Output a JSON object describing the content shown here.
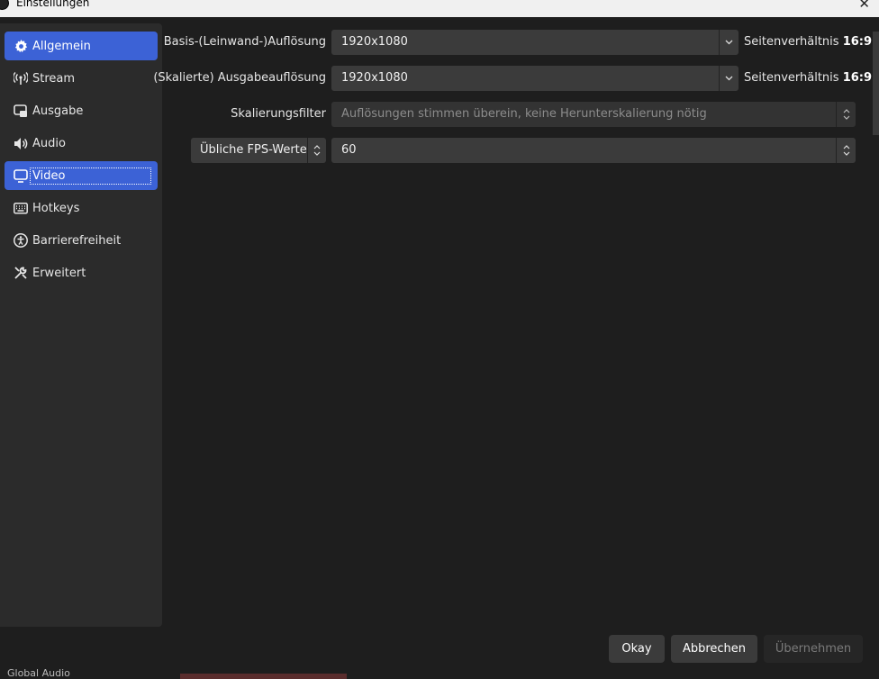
{
  "window": {
    "title": "Einstellungen",
    "close_glyph": "✕"
  },
  "sidebar": {
    "items": [
      {
        "label": "Allgemein",
        "icon": "gear-icon"
      },
      {
        "label": "Stream",
        "icon": "antenna-icon"
      },
      {
        "label": "Ausgabe",
        "icon": "output-icon"
      },
      {
        "label": "Audio",
        "icon": "speaker-icon"
      },
      {
        "label": "Video",
        "icon": "monitor-icon"
      },
      {
        "label": "Hotkeys",
        "icon": "keyboard-icon"
      },
      {
        "label": "Barrierefreiheit",
        "icon": "accessibility-icon"
      },
      {
        "label": "Erweitert",
        "icon": "tools-icon"
      }
    ]
  },
  "video": {
    "base_resolution": {
      "label": "Basis-(Leinwand-)Auflösung",
      "value": "1920x1080",
      "ratio_label": "Seitenverhältnis",
      "ratio_value": "16:9"
    },
    "output_resolution": {
      "label": "(Skalierte) Ausgabeauflösung",
      "value": "1920x1080",
      "ratio_label": "Seitenverhältnis",
      "ratio_value": "16:9"
    },
    "scale_filter": {
      "label": "Skalierungsfilter",
      "value": "Auflösungen stimmen überein, keine Herunterskalierung nötig"
    },
    "fps": {
      "type_label": "Übliche FPS-Werte",
      "value": "60"
    }
  },
  "buttons": {
    "okay": "Okay",
    "cancel": "Abbrechen",
    "apply": "Übernehmen"
  },
  "background": {
    "bottom_text": "Global Audio"
  },
  "colors": {
    "accent": "#3c62d6",
    "panel": "#2b2b2b",
    "background": "#1e1e1e"
  }
}
